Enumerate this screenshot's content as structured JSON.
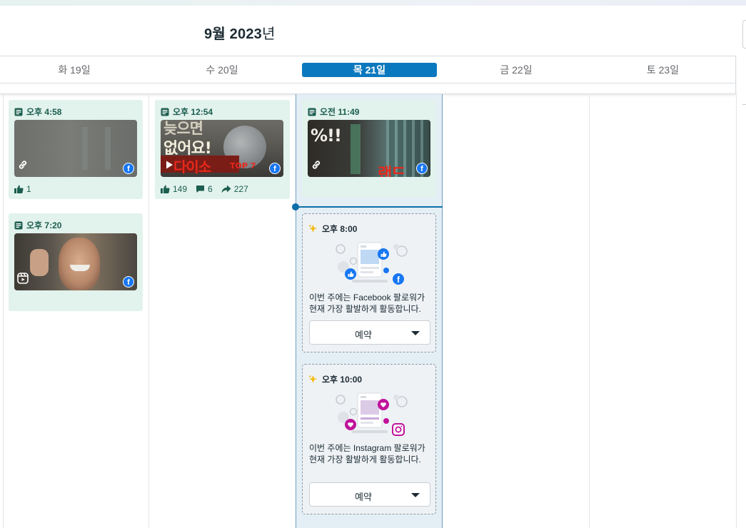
{
  "calendar": {
    "month_title": "9월 2023",
    "month_suffix": "년",
    "days": [
      {
        "label": "화 19일",
        "today": false
      },
      {
        "label": "수 20일",
        "today": false
      },
      {
        "label": "목 21일",
        "today": true
      },
      {
        "label": "금 22일",
        "today": false
      },
      {
        "label": "토 23일",
        "today": false
      }
    ]
  },
  "posts": [
    {
      "time": "오후 4:58",
      "type_icon": "link-icon",
      "platform_icon": "facebook-icon",
      "likes": "1"
    },
    {
      "time": "오후 7:20",
      "type_icon": "reels-icon",
      "platform_icon": "facebook-icon"
    },
    {
      "time": "오후 12:54",
      "type_icon": "play-icon",
      "platform_icon": "facebook-icon",
      "thumb_text_1": "늦으면",
      "thumb_text_2": "없어요!",
      "thumb_text_3": "다이소",
      "thumb_text_4": "TOP 7",
      "likes": "149",
      "comments": "6",
      "shares": "227"
    },
    {
      "time": "오전 11:49",
      "type_icon": "link-icon",
      "platform_icon": "facebook-icon",
      "thumb_text_1": "%!!",
      "thumb_text_2": "랜드"
    }
  ],
  "recommendations": [
    {
      "time": "오후 8:00",
      "platform": "facebook",
      "text": "이번 주에는 Facebook 팔로워가 현재 가장 활발하게 활동합니다.",
      "button_label": "예약"
    },
    {
      "time": "오후 10:00",
      "platform": "instagram",
      "text": "이번 주에는 Instagram 팔로워가 현재 가장 활발하게 활동합니다.",
      "button_label": "예약"
    }
  ],
  "colors": {
    "today_accent": "#0a78be",
    "post_card_bg": "#e2f2ec",
    "facebook": "#1877f2",
    "instagram_pink": "#c0139a",
    "star": "#f5b80f"
  }
}
